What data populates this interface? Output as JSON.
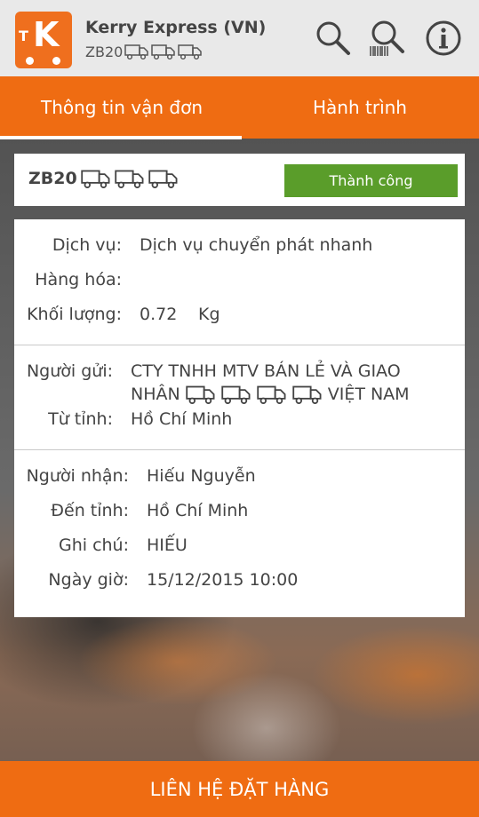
{
  "header": {
    "app_title": "Kerry Express (VN)",
    "code_prefix": "ZB20",
    "icons": [
      "search-icon",
      "barcode-search-icon",
      "info-icon"
    ]
  },
  "tabs": [
    {
      "label": "Thông tin vận đơn",
      "active": true
    },
    {
      "label": "Hành trình",
      "active": false
    }
  ],
  "shipment": {
    "code_prefix": "ZB20",
    "status": "Thành công"
  },
  "service": {
    "service_label": "Dịch vụ:",
    "service_value": "Dịch vụ chuyển phát nhanh",
    "goods_label": "Hàng hóa:",
    "goods_value": "",
    "weight_label": "Khối lượng:",
    "weight_value": "0.72",
    "weight_unit": "Kg"
  },
  "sender": {
    "sender_label": "Người gửi:",
    "sender_line1": "CTY TNHH MTV BÁN LẺ VÀ GIAO",
    "sender_line2_prefix": "NHÂN",
    "sender_line2_suffix": "VIỆT NAM",
    "from_label": "Từ tỉnh:",
    "from_value": "Hồ Chí Minh"
  },
  "receiver": {
    "receiver_label": "Người nhận:",
    "receiver_value": "Hiếu Nguyễn",
    "to_label": "Đến tỉnh:",
    "to_value": "Hồ Chí Minh",
    "note_label": "Ghi chú:",
    "note_value": "HIẾU",
    "datetime_label": "Ngày giờ:",
    "datetime_value": "15/12/2015 10:00"
  },
  "footer": {
    "button_label": "LIÊN HỆ ĐẶT HÀNG"
  },
  "colors": {
    "brand_orange": "#ef6c12",
    "success_green": "#5a9d2a",
    "header_bg": "#e9e9e9"
  }
}
